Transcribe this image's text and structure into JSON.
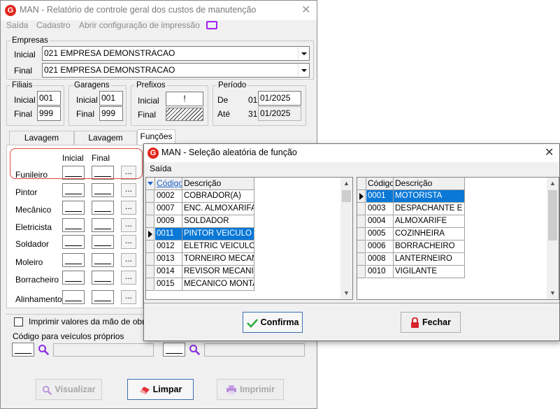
{
  "main": {
    "title": "MAN - Relatório de controle geral dos custos de manutenção",
    "menu": [
      "Saída",
      "Cadastro",
      "Abrir configuração de impressão"
    ],
    "empresas": {
      "legend": "Empresas",
      "inicial_label": "Inicial",
      "inicial_value": "021 EMPRESA DEMONSTRACAO",
      "final_label": "Final",
      "final_value": "021 EMPRESA DEMONSTRACAO"
    },
    "filiais": {
      "legend": "Filiais",
      "inicial_label": "Inicial",
      "inicial_value": "001",
      "final_label": "Final",
      "final_value": "999"
    },
    "garagens": {
      "legend": "Garagens",
      "inicial_label": "Inicial",
      "inicial_value": "001",
      "final_label": "Final",
      "final_value": "999"
    },
    "prefixos": {
      "legend": "Prefixos",
      "inicial_label": "Inicial",
      "inicial_value": "!",
      "final_label": "Final"
    },
    "periodo": {
      "legend": "Período",
      "de_label": "De",
      "de_day": "01",
      "de_value": "01/2025",
      "ate_label": "Até",
      "ate_day": "31",
      "ate_value": "01/2025"
    },
    "tabs": [
      "Lavagem externa",
      "Lavagem interna",
      "Funções"
    ],
    "funcoes": {
      "col_inicial": "Inicial",
      "col_final": "Final",
      "button_label": "...",
      "rows": [
        "Funileiro",
        "Pintor",
        "Mecânico",
        "Eletricista",
        "Soldador",
        "Moleiro",
        "Borracheiro",
        "Alinhamento"
      ]
    },
    "imprimir_label": "Imprimir valores da mão de obra po",
    "codigo_label": "Código para veículos próprios",
    "buttons": {
      "visualizar": "Visualizar",
      "limpar": "Limpar",
      "imprimir": "Imprimir"
    }
  },
  "dialog": {
    "title": "MAN - Seleção aleatória de função",
    "menu": "Saída",
    "left_grid": {
      "headers": [
        "Código",
        "Descrição"
      ],
      "rows": [
        {
          "code": "0002",
          "desc": "COBRADOR(A)"
        },
        {
          "code": "0007",
          "desc": "ENC. ALMOXARIFADO"
        },
        {
          "code": "0009",
          "desc": "SOLDADOR"
        },
        {
          "code": "0011",
          "desc": "PINTOR VEICULO"
        },
        {
          "code": "0012",
          "desc": "ELETRIC VEICULO"
        },
        {
          "code": "0013",
          "desc": "TORNEIRO MECANICO"
        },
        {
          "code": "0014",
          "desc": "REVISOR MECANICO"
        },
        {
          "code": "0015",
          "desc": "MECANICO MONTADOR"
        }
      ],
      "selected_index": 3
    },
    "right_grid": {
      "headers": [
        "Código",
        "Descrição"
      ],
      "rows": [
        {
          "code": "0001",
          "desc": "MOTORISTA"
        },
        {
          "code": "0003",
          "desc": "DESPACHANTE E FI"
        },
        {
          "code": "0004",
          "desc": "ALMOXARIFE"
        },
        {
          "code": "0005",
          "desc": "COZINHEIRA"
        },
        {
          "code": "0006",
          "desc": "BORRACHEIRO"
        },
        {
          "code": "0008",
          "desc": "LANTERNEIRO"
        },
        {
          "code": "0010",
          "desc": "VIGILANTE"
        }
      ],
      "selected_index": 0
    },
    "buttons": {
      "confirma": "Confirma",
      "fechar": "Fechar"
    }
  },
  "colors": {
    "selection": "#0a78d7",
    "highlight_box": "#e0453a",
    "logo": "#e1261c",
    "icon_purple": "#8a2be2"
  }
}
